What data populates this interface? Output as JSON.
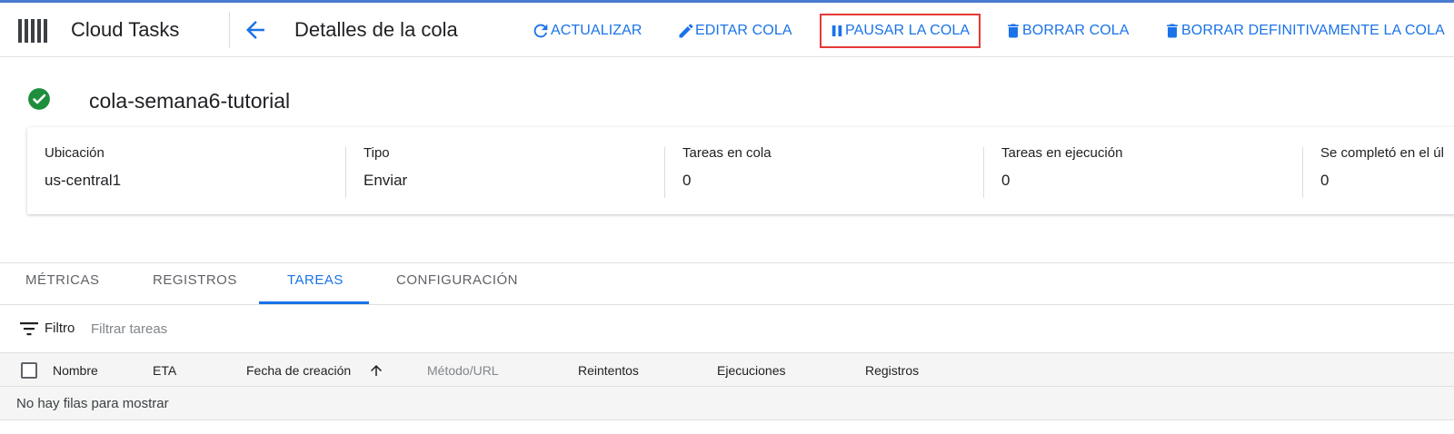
{
  "app": {
    "title": "Cloud Tasks"
  },
  "header": {
    "page_title": "Detalles de la cola",
    "actions": {
      "refresh": "ACTUALIZAR",
      "edit": "EDITAR COLA",
      "pause": "PAUSAR LA COLA",
      "delete": "BORRAR COLA",
      "purge": "BORRAR DEFINITIVAMENTE LA COLA"
    }
  },
  "queue": {
    "name": "cola-semana6-tutorial",
    "status_icon": "check-circle-icon",
    "info": [
      {
        "label": "Ubicación",
        "value": "us-central1"
      },
      {
        "label": "Tipo",
        "value": "Enviar"
      },
      {
        "label": "Tareas en cola",
        "value": "0"
      },
      {
        "label": "Tareas en ejecución",
        "value": "0"
      },
      {
        "label": "Se completó en el úl",
        "value": "0"
      }
    ]
  },
  "tabs": [
    {
      "label": "MÉTRICAS",
      "active": false
    },
    {
      "label": "REGISTROS",
      "active": false
    },
    {
      "label": "TAREAS",
      "active": true
    },
    {
      "label": "CONFIGURACIÓN",
      "active": false
    }
  ],
  "filter": {
    "label": "Filtro",
    "placeholder": "Filtrar tareas"
  },
  "table": {
    "columns": [
      "Nombre",
      "ETA",
      "Fecha de creación",
      "Método/URL",
      "Reintentos",
      "Ejecuciones",
      "Registros"
    ],
    "sort_column": "Fecha de creación",
    "sort_direction": "ascending",
    "empty_message": "No hay filas para mostrar"
  },
  "colors": {
    "accent": "#1a73e8",
    "success": "#1e8e3e",
    "highlight_border": "#e53935"
  }
}
